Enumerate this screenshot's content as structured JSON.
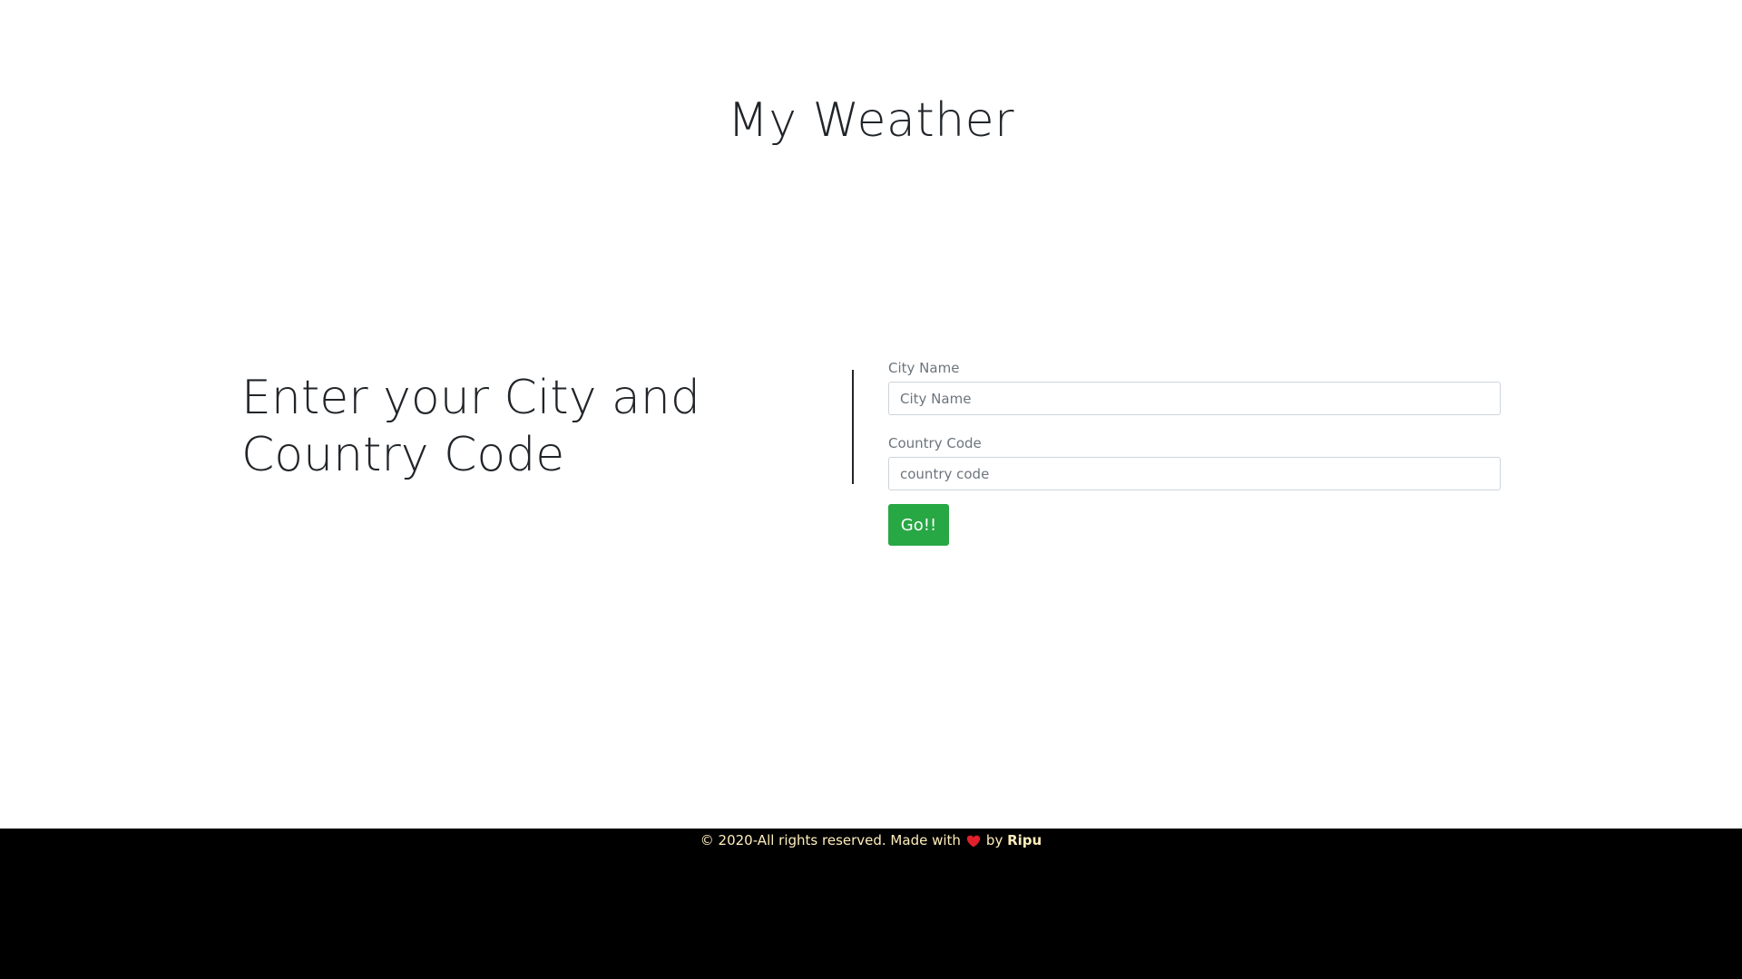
{
  "header": {
    "title": "My Weather"
  },
  "main": {
    "prompt": "Enter your City and Country Code",
    "form": {
      "city_label": "City Name",
      "city_placeholder": "City Name",
      "city_value": "",
      "country_label": "Country Code",
      "country_placeholder": "country code",
      "country_value": "",
      "submit_label": "Go!!"
    }
  },
  "footer": {
    "copyright": "© 2020-All rights reserved. Made with",
    "heart_icon": "heart-icon",
    "by": "by",
    "author": "Ripu"
  },
  "colors": {
    "accent": "#28a745",
    "footer_bg": "#000000",
    "footer_text": "#ffeeba",
    "heart": "#e0202c"
  }
}
